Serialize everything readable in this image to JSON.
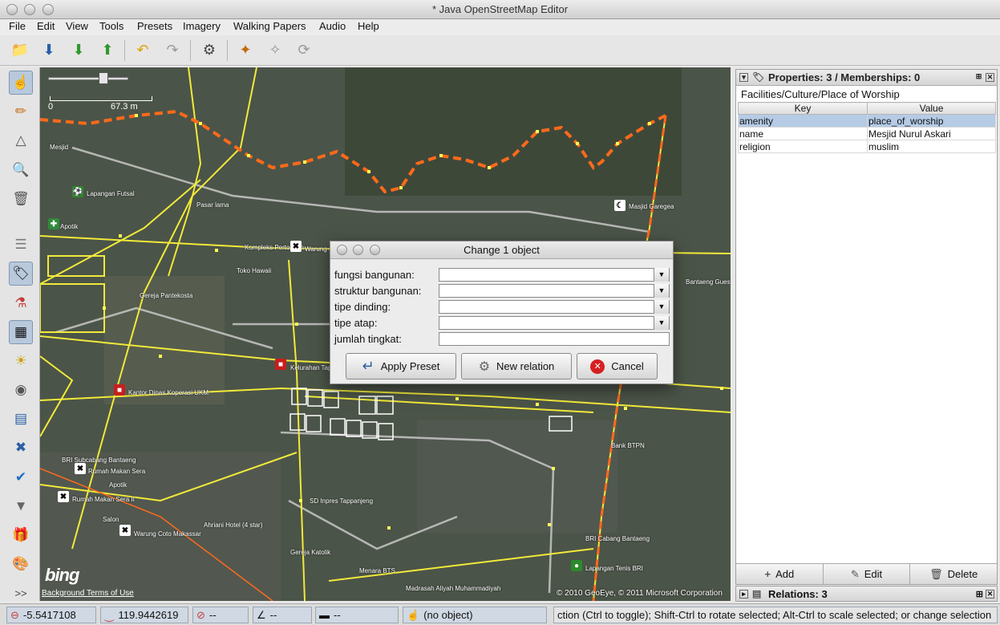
{
  "window": {
    "title": "* Java OpenStreetMap Editor"
  },
  "menu": [
    {
      "label": "File"
    },
    {
      "label": "Edit"
    },
    {
      "label": "View"
    },
    {
      "label": "Tools"
    },
    {
      "label": "Presets"
    },
    {
      "label": "Imagery"
    },
    {
      "label": "Walking Papers"
    },
    {
      "label": "Audio"
    },
    {
      "label": "Help"
    }
  ],
  "map": {
    "scale_zero": "0",
    "scale_label": "67.3 m",
    "provider_logo": "bing",
    "background_terms": "Background Terms of Use",
    "copyright": "© 2010 GeoEye, © 2011 Microsoft Corporation",
    "labels": [
      "Mesjid",
      "Lapangan Futsal",
      "Pasar lama",
      "Apotik",
      "Kompleks Pertokoan",
      "Warung",
      "Toko Hawaii",
      "Gereja Pantekosta",
      "Masjid Garegea",
      "Bantaeng Guest",
      "Kelurahan Tap",
      "Kantor Dinas Koperasi UKM",
      "Bank BTPN",
      "BRI Subcabang Bantaeng",
      "Rumah Makan Sera",
      "Apotik",
      "Rumah Makan Sera II",
      "SD Inpres Tappanjeng",
      "Salon",
      "Ahriani Hotel (4 star)",
      "Warung Coto Makassar",
      "Gereja Katolik",
      "Menara BTS",
      "Madrasah Aliyah Muhammadiyah",
      "BRI Cabang Bantaeng",
      "Lapangan Tenis BRI"
    ]
  },
  "properties_panel": {
    "header": "Properties: 3 / Memberships: 0",
    "preset": "Facilities/Culture/Place of Worship",
    "col_key": "Key",
    "col_value": "Value",
    "rows": [
      {
        "key": "amenity",
        "value": "place_of_worship"
      },
      {
        "key": "name",
        "value": "Mesjid Nurul Askari"
      },
      {
        "key": "religion",
        "value": "muslim"
      }
    ],
    "buttons": {
      "add": "Add",
      "edit": "Edit",
      "delete": "Delete"
    }
  },
  "relations_panel": {
    "header": "Relations: 3"
  },
  "dialog": {
    "title": "Change 1 object",
    "fields": [
      {
        "label": "fungsi bangunan:",
        "value": ""
      },
      {
        "label": "struktur bangunan:",
        "value": ""
      },
      {
        "label": "tipe dinding:",
        "value": ""
      },
      {
        "label": "tipe atap:",
        "value": ""
      },
      {
        "label": "jumlah tingkat:",
        "value": ""
      }
    ],
    "buttons": {
      "apply": "Apply Preset",
      "new_relation": "New relation",
      "cancel": "Cancel"
    }
  },
  "status": {
    "lat": "-5.5417108",
    "lon": "119.9442619",
    "heading": "--",
    "angle": "--",
    "length": "--",
    "selection": "(no object)",
    "help": "ction (Ctrl to toggle); Shift-Ctrl to rotate selected; Alt-Ctrl to scale selected; or change selection"
  },
  "colors": {
    "road": "#f2ea3a",
    "track": "#ff6a1a",
    "selection": "#b5cbe6"
  }
}
